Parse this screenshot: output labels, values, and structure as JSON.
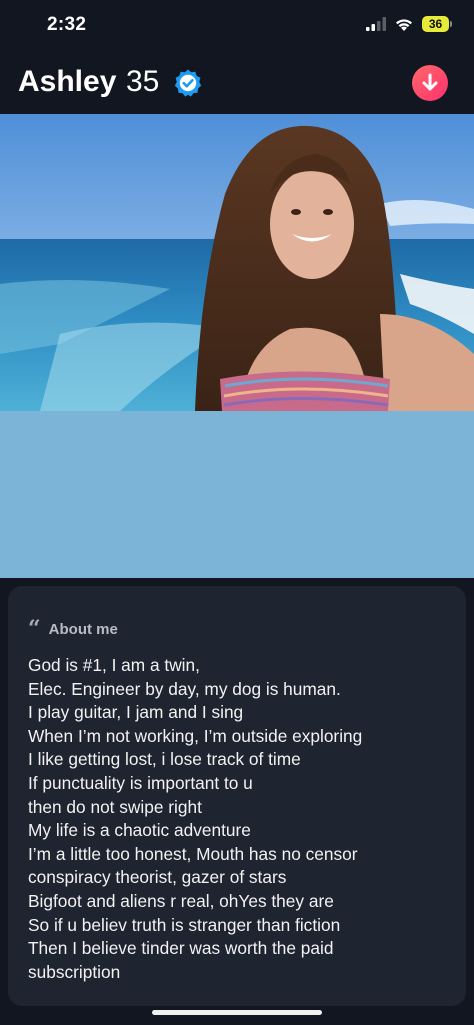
{
  "status_bar": {
    "time": "2:32",
    "battery_level": "36",
    "icons": [
      "signal-icon",
      "wifi-icon",
      "battery-icon"
    ]
  },
  "profile": {
    "name": "Ashley",
    "age": "35",
    "verified": true,
    "verified_color": "#1d9bf0",
    "accent": "#ff4d6d"
  },
  "about": {
    "heading": "About me",
    "lines": [
      "God is #1, I am a twin,",
      "Elec. Engineer by day, my dog is human.",
      "I play guitar, I jam and I sing",
      "When I’m not working, I’m outside exploring",
      "I like getting lost, i lose track of time",
      "If punctuality is important to u",
      "then do not swipe right",
      "My life is a chaotic adventure",
      "I’m a little too honest, Mouth has no censor",
      "conspiracy theorist, gazer of stars",
      "Bigfoot and aliens r real, ohYes they are",
      "So if u believ truth is stranger than fiction",
      "Then I believe tinder was worth the paid",
      "subscription"
    ]
  }
}
